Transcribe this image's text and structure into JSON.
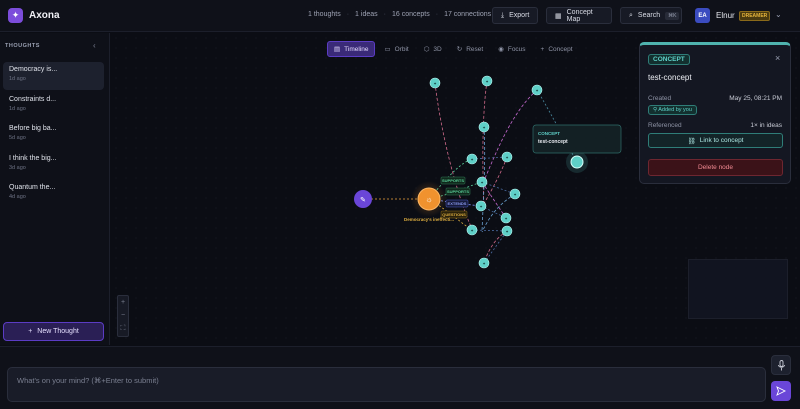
{
  "app": {
    "title": "Axona"
  },
  "header": {
    "stats": [
      "1 thoughts",
      "1 ideas",
      "16 concepts",
      "17 connections"
    ],
    "export_label": "Export",
    "concept_map_label": "Concept Map",
    "search_label": "Search",
    "search_shortcut": "⌘K",
    "user": {
      "initials": "EA",
      "name": "Elnur",
      "tier": "DREAMER"
    }
  },
  "sidebar": {
    "title": "THOUGHTS",
    "items": [
      {
        "title": "Democracy is...",
        "age": "1d ago",
        "active": true
      },
      {
        "title": "Constraints d...",
        "age": "1d ago"
      },
      {
        "title": "Before big ba...",
        "age": "5d ago"
      },
      {
        "title": "I think the big...",
        "age": "3d ago"
      },
      {
        "title": "Quantum the...",
        "age": "4d ago"
      }
    ],
    "new_thought_label": "New Thought"
  },
  "toolbar": {
    "modes": [
      "Timeline",
      "Orbit",
      "3D",
      "Reset",
      "Focus",
      "Concept"
    ],
    "active": "Timeline"
  },
  "graph": {
    "center_label": "Democracy's ineffecti...",
    "edge_labels": [
      "SUPPORTS",
      "SUPPORTS",
      "EXTENDS",
      "QUESTIONS"
    ],
    "tooltip": {
      "kind": "CONCEPT",
      "name": "test-concept"
    }
  },
  "panel": {
    "kind": "CONCEPT",
    "name": "test-concept",
    "created_label": "Created",
    "created_value": "May 25, 08:21 PM",
    "added_by": "Added by you",
    "referenced_label": "Referenced",
    "referenced_value": "1× in ideas",
    "link_label": "Link to concept",
    "delete_label": "Delete node"
  },
  "composer": {
    "placeholder": "What's on your mind? (⌘+Enter to submit)"
  },
  "colors": {
    "accent": "#6a46d8",
    "concept": "#4fc8c4",
    "thought": "#f0922e",
    "delete": "#f08a92"
  }
}
